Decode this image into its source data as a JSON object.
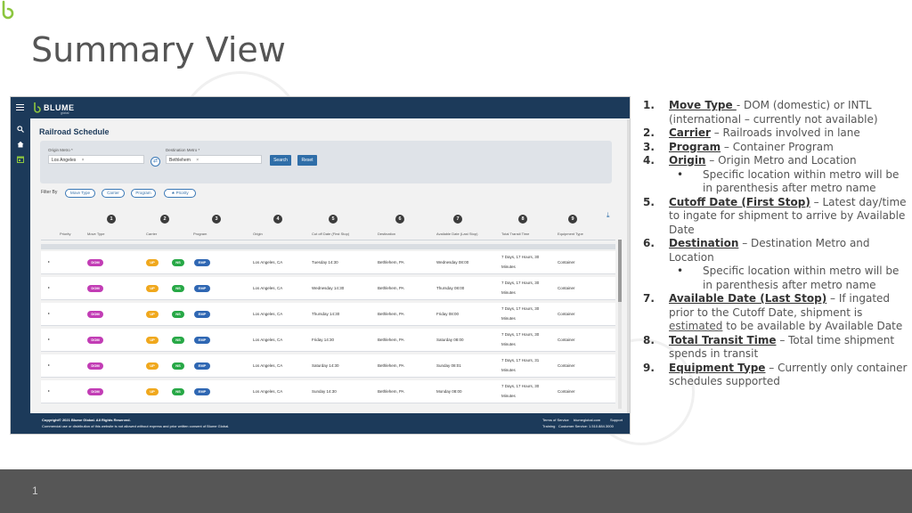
{
  "slide": {
    "title": "Summary View",
    "page_number": "1"
  },
  "app": {
    "brand": "BLUME",
    "brand_sub": "global",
    "page_title": "Railroad Schedule",
    "origin_label": "Origin Metro *",
    "origin_value": "Los Angeles",
    "destination_label": "Destination Metro *",
    "destination_value": "Bethlehem",
    "search_label": "Search",
    "reset_label": "Reset",
    "filter_by": "Filter By",
    "filters": [
      "Move Type",
      "Carrier",
      "Program",
      "Priority"
    ],
    "columns": [
      "Priority",
      "Move Type",
      "Carrier",
      "Program",
      "Origin",
      "Cut off Date (First Stop)",
      "Destination",
      "Available Date (Last Stop)",
      "Total Transit Time",
      "Equipment Type"
    ],
    "column_numbers": [
      "1",
      "2",
      "3",
      "4",
      "5",
      "6",
      "7",
      "8",
      "9"
    ],
    "rows": [
      {
        "move": "DOM",
        "carrier1": "UP",
        "carrier2": "NS",
        "program": "EMP",
        "origin": "Los Angeles, CA",
        "cutoff": "Tuesday 14:30",
        "destination": "Bethlehem, PA",
        "available": "Wednesday 08:00",
        "transit1": "7 Days, 17 Hours, 30",
        "transit2": "Minutes",
        "equipment": "Container"
      },
      {
        "move": "DOM",
        "carrier1": "UP",
        "carrier2": "NS",
        "program": "EMP",
        "origin": "Los Angeles, CA",
        "cutoff": "Wednesday 14:30",
        "destination": "Bethlehem, PA",
        "available": "Thursday 08:00",
        "transit1": "7 Days, 17 Hours, 30",
        "transit2": "Minutes",
        "equipment": "Container"
      },
      {
        "move": "DOM",
        "carrier1": "UP",
        "carrier2": "NS",
        "program": "EMP",
        "origin": "Los Angeles, CA",
        "cutoff": "Thursday 14:30",
        "destination": "Bethlehem, PA",
        "available": "Friday 08:00",
        "transit1": "7 Days, 17 Hours, 30",
        "transit2": "Minutes",
        "equipment": "Container"
      },
      {
        "move": "DOM",
        "carrier1": "UP",
        "carrier2": "NS",
        "program": "EMP",
        "origin": "Los Angeles, CA",
        "cutoff": "Friday 14:30",
        "destination": "Bethlehem, PA",
        "available": "Saturday 08:00",
        "transit1": "7 Days, 17 Hours, 30",
        "transit2": "Minutes",
        "equipment": "Container"
      },
      {
        "move": "DOM",
        "carrier1": "UP",
        "carrier2": "NS",
        "program": "EMP",
        "origin": "Los Angeles, CA",
        "cutoff": "Saturday 14:30",
        "destination": "Bethlehem, PA",
        "available": "Sunday 08:01",
        "transit1": "7 Days, 17 Hours, 31",
        "transit2": "Minutes",
        "equipment": "Container"
      },
      {
        "move": "DOM",
        "carrier1": "UP",
        "carrier2": "NS",
        "program": "EMP",
        "origin": "Los Angeles, CA",
        "cutoff": "Sunday 14:30",
        "destination": "Bethlehem, PA",
        "available": "Monday 08:00",
        "transit1": "7 Days, 17 Hours, 30",
        "transit2": "Minutes",
        "equipment": "Container"
      }
    ],
    "footer_left1": "Copyright© 2021 Blume Global. All Rights Reserved.",
    "footer_left2": "Commercial use or distribution of this website is not allowed without express and prior written consent of Blume Global.",
    "footer_links1": [
      "Terms of Service",
      "blumeglobal.com",
      "Support"
    ],
    "footer_links2": [
      "Training",
      "Customer Service: 1.510.884.3000"
    ],
    "colors": {
      "nav": "#1c3a5a",
      "dom": "#c23db5",
      "up": "#f0a81d",
      "ns": "#27a846",
      "emp": "#2f67b3"
    }
  },
  "notes": [
    {
      "n": "1.",
      "kw": "Move Type ",
      "text": "- DOM (domestic) or INTL (international – currently not available)"
    },
    {
      "n": "2.",
      "kw": "Carrier",
      "text": " – Railroads involved in lane"
    },
    {
      "n": "3.",
      "kw": "Program",
      "text": " – Container Program"
    },
    {
      "n": "4.",
      "kw": "Origin",
      "text": " – Origin Metro and Location",
      "sub": "Specific location within metro will be in parenthesis after metro name"
    },
    {
      "n": "5.",
      "kw": "Cutoff Date (First Stop)",
      "text": " – Latest day/time to ingate for shipment to arrive by Available Date"
    },
    {
      "n": "6.",
      "kw": "Destination",
      "text": " – Destination Metro and Location",
      "sub": "Specific location within metro will be in parenthesis after metro name"
    },
    {
      "n": "7.",
      "kw": "Available Date (Last Stop)",
      "text_a": " – If ingated prior to the Cutoff Date, shipment is ",
      "text_u": "estimated",
      "text_b": " to be available by Available Date"
    },
    {
      "n": "8.",
      "kw": "Total Transit Time",
      "text": " – Total time shipment spends in transit"
    },
    {
      "n": "9.",
      "kw": "Equipment Type",
      "text": " – Currently only container schedules supported"
    }
  ]
}
